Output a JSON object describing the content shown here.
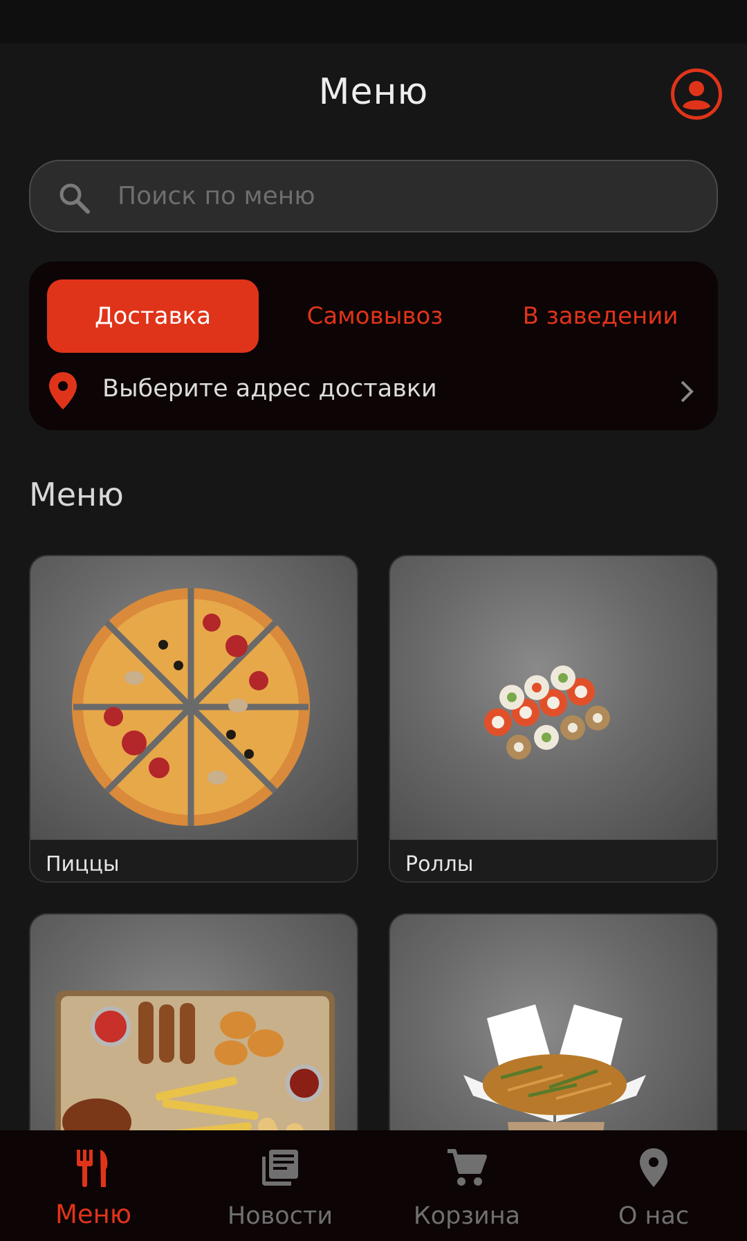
{
  "header": {
    "title": "Меню",
    "profile_icon": "account-circle-icon"
  },
  "search": {
    "placeholder": "Поиск по меню",
    "value": ""
  },
  "order_type": {
    "tabs": [
      {
        "label": "Доставка",
        "active": true
      },
      {
        "label": "Самовывоз",
        "active": false
      },
      {
        "label": "В заведении",
        "active": false
      }
    ],
    "address_label": "Выберите адрес доставки"
  },
  "menu": {
    "section_title": "Меню",
    "categories": [
      {
        "label": "Пиццы",
        "image": "pizza"
      },
      {
        "label": "Роллы",
        "image": "sushi-rolls"
      },
      {
        "label": "",
        "image": "snacks-platter"
      },
      {
        "label": "",
        "image": "wok-noodles-box"
      }
    ]
  },
  "bottom_nav": {
    "items": [
      {
        "label": "Меню",
        "icon": "restaurant-icon",
        "active": true
      },
      {
        "label": "Новости",
        "icon": "news-icon",
        "active": false
      },
      {
        "label": "Корзина",
        "icon": "cart-icon",
        "active": false
      },
      {
        "label": "О нас",
        "icon": "location-pin-icon",
        "active": false
      }
    ]
  },
  "colors": {
    "accent": "#e0341a",
    "background": "#161616",
    "card": "#0c0405"
  }
}
